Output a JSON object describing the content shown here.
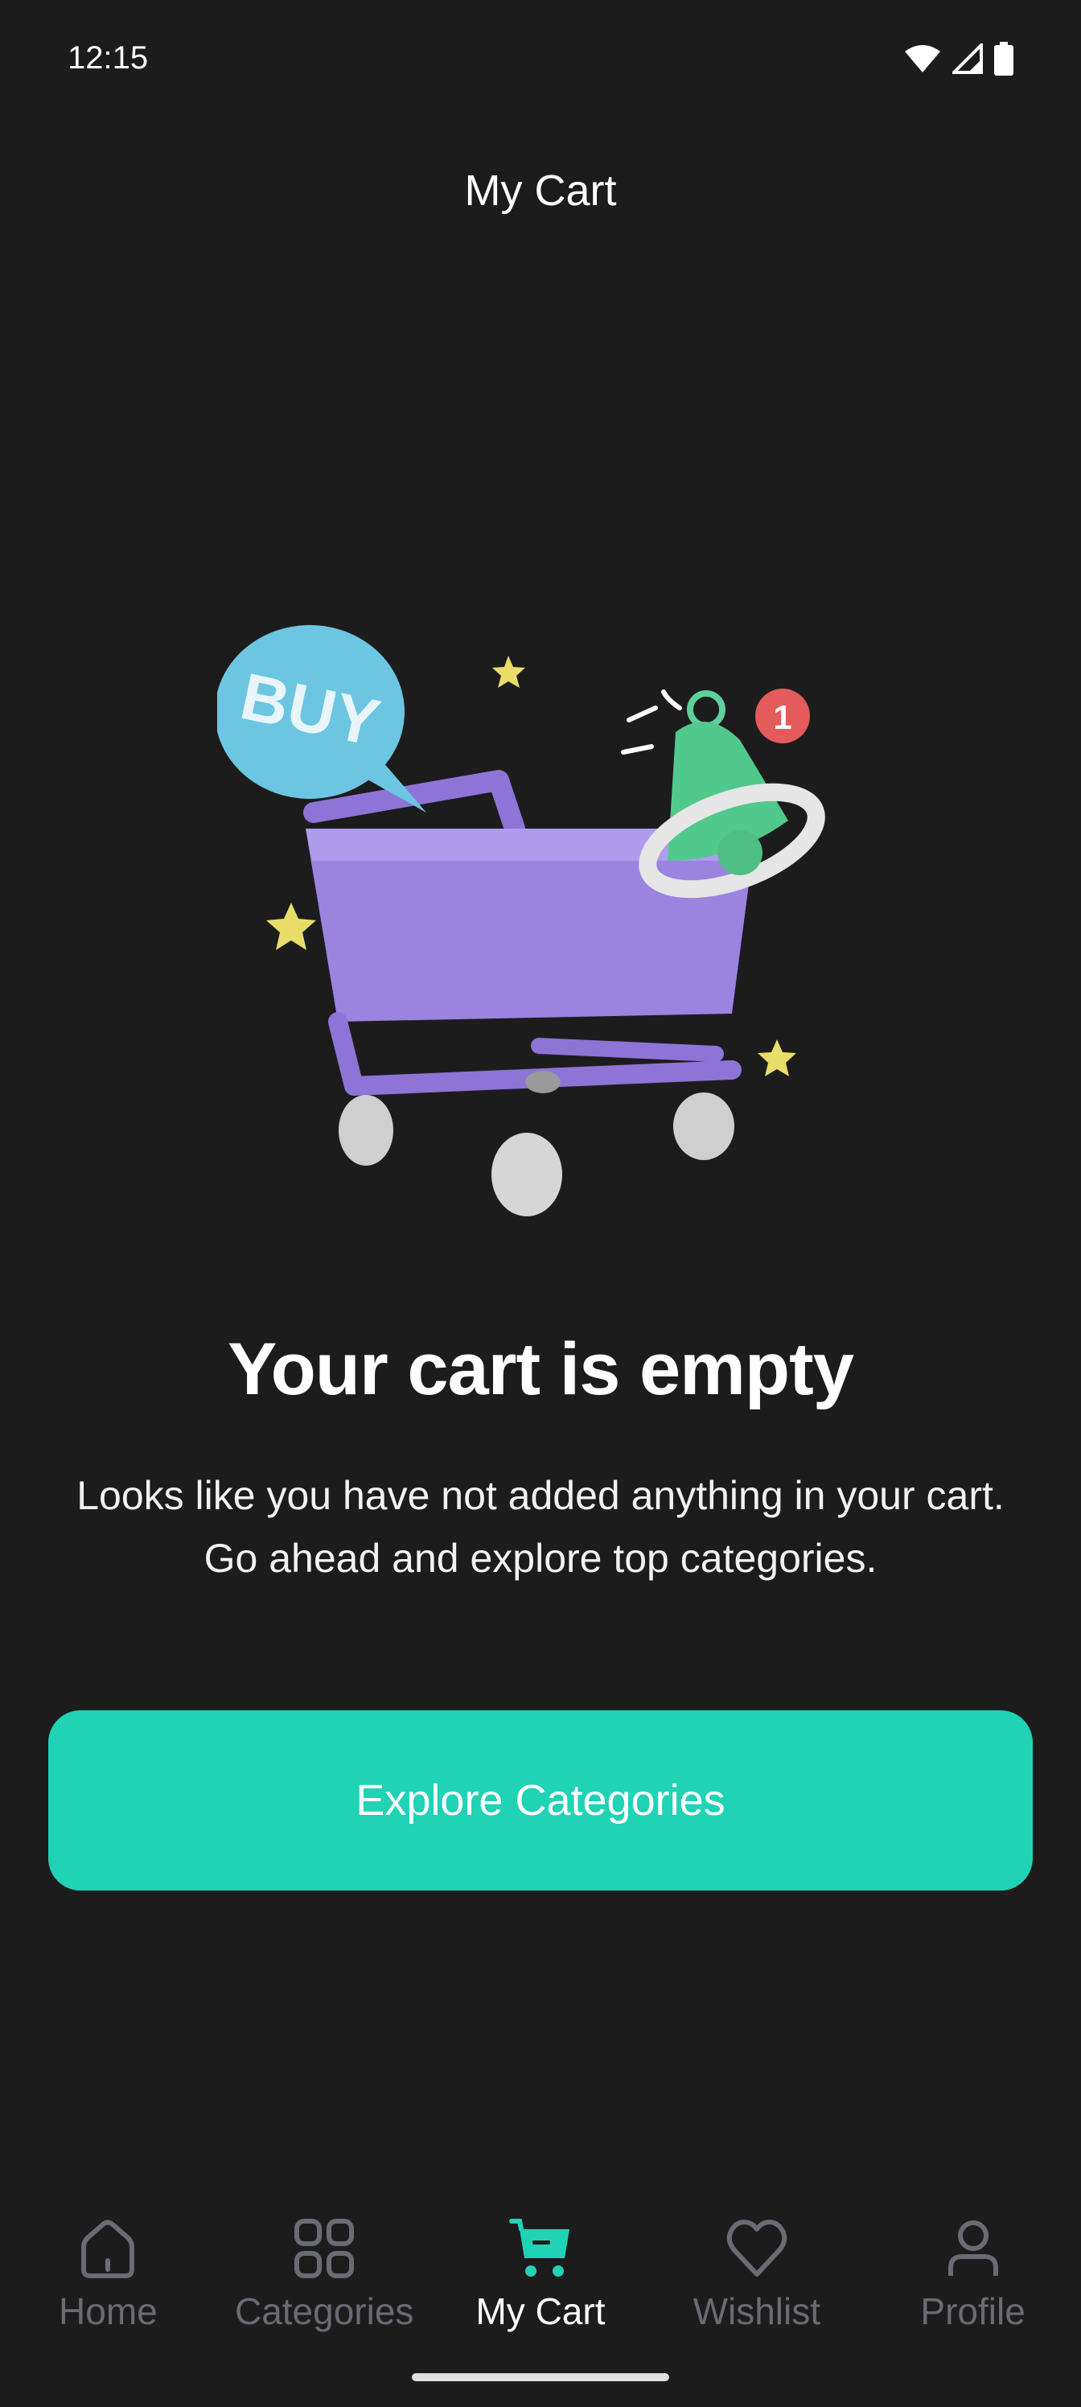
{
  "status_bar": {
    "time": "12:15"
  },
  "header": {
    "title": "My Cart"
  },
  "illustration": {
    "bubble_text": "BUY",
    "badge_count": "1"
  },
  "empty_state": {
    "heading": "Your cart is empty",
    "message": "Looks like you have not added anything in your cart. Go ahead and explore top categories.",
    "button_label": "Explore Categories"
  },
  "bottom_nav": {
    "items": [
      {
        "label": "Home",
        "icon": "home-icon",
        "active": false
      },
      {
        "label": "Categories",
        "icon": "grid-icon",
        "active": false
      },
      {
        "label": "My Cart",
        "icon": "cart-icon",
        "active": true
      },
      {
        "label": "Wishlist",
        "icon": "heart-icon",
        "active": false
      },
      {
        "label": "Profile",
        "icon": "person-icon",
        "active": false
      }
    ]
  },
  "colors": {
    "background": "#1c1c1d",
    "accent": "#20d3b5",
    "inactive_nav": "#6a6b73",
    "cart_purple": "#9b84e0"
  }
}
